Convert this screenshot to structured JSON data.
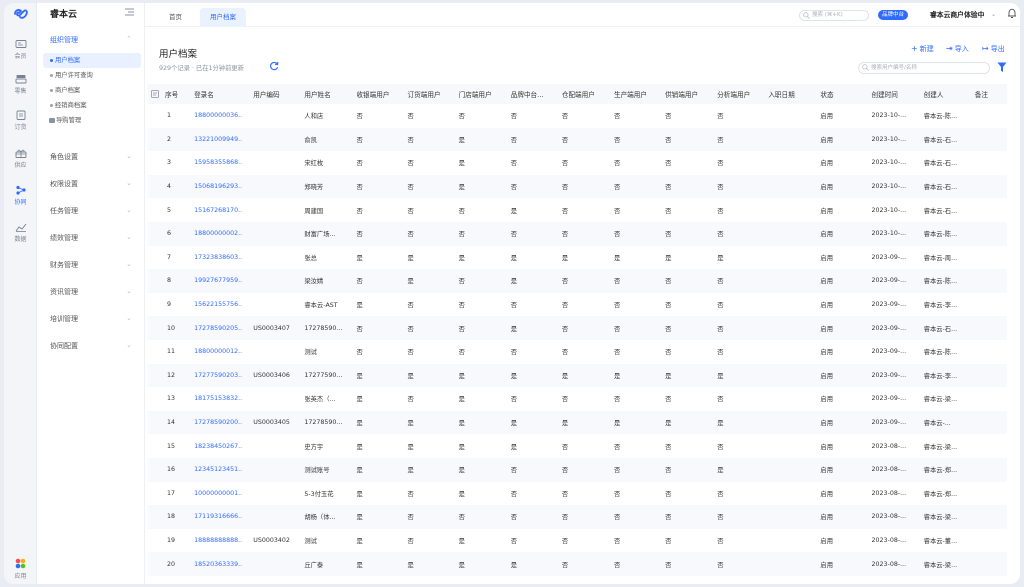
{
  "rail": {
    "items": [
      {
        "label": "会员",
        "icon": "member-card-icon"
      },
      {
        "label": "零售",
        "icon": "retail-register-icon"
      },
      {
        "label": "订货",
        "icon": "order-clipboard-icon"
      },
      {
        "label": "供应",
        "icon": "supply-gift-icon"
      },
      {
        "label": "协同",
        "icon": "collaboration-nodes-icon"
      },
      {
        "label": "数据",
        "icon": "data-chart-icon"
      }
    ],
    "apps_label": "应用"
  },
  "sidebar": {
    "brand": "睿本云",
    "groups": [
      {
        "label": "组织管理",
        "subs": [
          "用户档案",
          "用户许可查询",
          "商户档案",
          "经销商档案"
        ]
      },
      {
        "label": "导购管理",
        "folder": true
      },
      {
        "label": "角色设置"
      },
      {
        "label": "权限设置"
      },
      {
        "label": "任务管理"
      },
      {
        "label": "绩效管理"
      },
      {
        "label": "财务管理"
      },
      {
        "label": "资讯管理"
      },
      {
        "label": "培训管理"
      },
      {
        "label": "协同配置"
      }
    ]
  },
  "topbar": {
    "tabs": [
      "首页",
      "用户档案"
    ],
    "search_placeholder": "搜索 (⌘+K)",
    "env_badge": "品牌中台",
    "env_name": "睿本云商户体验中"
  },
  "main": {
    "title": "用户档案",
    "meta": "929个记录 · 已在1分钟前更新",
    "actions": {
      "new": "新建",
      "import": "导入",
      "export": "导出"
    },
    "search_placeholder": "搜索用户编号/名称",
    "columns": [
      "序号",
      "登录名",
      "用户编码",
      "用户姓名",
      "收银端用户",
      "订货端用户",
      "门店端用户",
      "品牌中台...",
      "仓配端用户",
      "生产端用户",
      "供销端用户",
      "分析端用户",
      "入职日期",
      "状态",
      "创建时间",
      "创建人",
      "备注"
    ],
    "rows": [
      [
        "1",
        "18800000036..",
        "",
        "人和店",
        "否",
        "否",
        "否",
        "否",
        "否",
        "否",
        "否",
        "否",
        "",
        "启用",
        "2023-10-...",
        "睿本云-陈...",
        ""
      ],
      [
        "2",
        "13221009949..",
        "",
        "俞凯",
        "否",
        "否",
        "是",
        "否",
        "否",
        "否",
        "否",
        "否",
        "",
        "启用",
        "2023-10-...",
        "睿本云-石...",
        ""
      ],
      [
        "3",
        "15958355868..",
        "",
        "宋红枚",
        "否",
        "否",
        "是",
        "否",
        "否",
        "否",
        "否",
        "否",
        "",
        "启用",
        "2023-10-...",
        "睿本云-石...",
        ""
      ],
      [
        "4",
        "15068196293..",
        "",
        "郑晓芳",
        "否",
        "否",
        "是",
        "否",
        "否",
        "否",
        "否",
        "否",
        "",
        "启用",
        "2023-10-...",
        "睿本云-石...",
        ""
      ],
      [
        "5",
        "15167268170..",
        "",
        "周建国",
        "否",
        "否",
        "否",
        "是",
        "否",
        "否",
        "否",
        "否",
        "",
        "启用",
        "2023-10-...",
        "睿本云-石...",
        ""
      ],
      [
        "6",
        "18800000002..",
        "",
        "财富广场...",
        "否",
        "否",
        "否",
        "否",
        "否",
        "否",
        "否",
        "否",
        "",
        "启用",
        "2023-10-...",
        "睿本云-陈...",
        ""
      ],
      [
        "7",
        "17323838603..",
        "",
        "张总",
        "是",
        "是",
        "是",
        "是",
        "是",
        "是",
        "是",
        "是",
        "",
        "启用",
        "2023-09-...",
        "睿本云-周...",
        ""
      ],
      [
        "8",
        "19927677959..",
        "",
        "梁汝婧",
        "否",
        "是",
        "否",
        "是",
        "否",
        "否",
        "否",
        "否",
        "",
        "启用",
        "2023-09-...",
        "睿本云-陈...",
        ""
      ],
      [
        "9",
        "15622155756..",
        "",
        "睿本云-AST",
        "是",
        "否",
        "否",
        "否",
        "否",
        "否",
        "否",
        "否",
        "",
        "启用",
        "2023-09-...",
        "睿本云-李...",
        ""
      ],
      [
        "10",
        "17278590205..",
        "US0003407",
        "17278590...",
        "否",
        "否",
        "否",
        "是",
        "否",
        "否",
        "否",
        "否",
        "",
        "启用",
        "2023-09-...",
        "睿本云-石...",
        ""
      ],
      [
        "11",
        "18800000012..",
        "",
        "测试",
        "否",
        "否",
        "否",
        "否",
        "否",
        "否",
        "否",
        "否",
        "",
        "启用",
        "2023-09-...",
        "睿本云-陈...",
        ""
      ],
      [
        "12",
        "17277590203..",
        "US0003406",
        "17277590...",
        "是",
        "是",
        "是",
        "是",
        "是",
        "是",
        "是",
        "是",
        "",
        "启用",
        "2023-09-...",
        "睿本云-李...",
        ""
      ],
      [
        "13",
        "18175153832..",
        "",
        "张英杰（...",
        "是",
        "否",
        "是",
        "否",
        "否",
        "否",
        "否",
        "否",
        "",
        "启用",
        "2023-09-...",
        "睿本云-梁...",
        ""
      ],
      [
        "14",
        "17278590200..",
        "US0003405",
        "17278590...",
        "是",
        "是",
        "是",
        "是",
        "是",
        "是",
        "是",
        "是",
        "",
        "启用",
        "2023-09-...",
        "睿本云-...",
        ""
      ],
      [
        "15",
        "18238450267..",
        "",
        "史方宇",
        "是",
        "是",
        "是",
        "是",
        "否",
        "否",
        "否",
        "否",
        "",
        "启用",
        "2023-08-...",
        "睿本云-梁...",
        ""
      ],
      [
        "16",
        "12345123451..",
        "",
        "测试账号",
        "是",
        "是",
        "是",
        "否",
        "否",
        "否",
        "否",
        "是",
        "",
        "启用",
        "2023-08-...",
        "睿本云-郑...",
        ""
      ],
      [
        "17",
        "10000000001..",
        "",
        "5-3付玉花",
        "是",
        "否",
        "是",
        "否",
        "否",
        "否",
        "否",
        "否",
        "",
        "启用",
        "2023-08-...",
        "睿本云-郑...",
        ""
      ],
      [
        "18",
        "17119316666..",
        "",
        "胡杨（体...",
        "是",
        "否",
        "否",
        "否",
        "否",
        "否",
        "否",
        "否",
        "",
        "启用",
        "2023-08-...",
        "睿本云-梁...",
        ""
      ],
      [
        "19",
        "18888888888..",
        "US0003402",
        "测试",
        "是",
        "否",
        "是",
        "否",
        "否",
        "否",
        "否",
        "否",
        "",
        "启用",
        "2023-08-...",
        "睿本云-董...",
        ""
      ],
      [
        "20",
        "18520363339..",
        "",
        "丘广泰",
        "是",
        "是",
        "是",
        "是",
        "否",
        "否",
        "否",
        "否",
        "",
        "启用",
        "2023-08-...",
        "睿本云-梁...",
        ""
      ]
    ]
  },
  "colors": {
    "accent": "#2f6bff",
    "active_bg": "#e9f0ff"
  }
}
